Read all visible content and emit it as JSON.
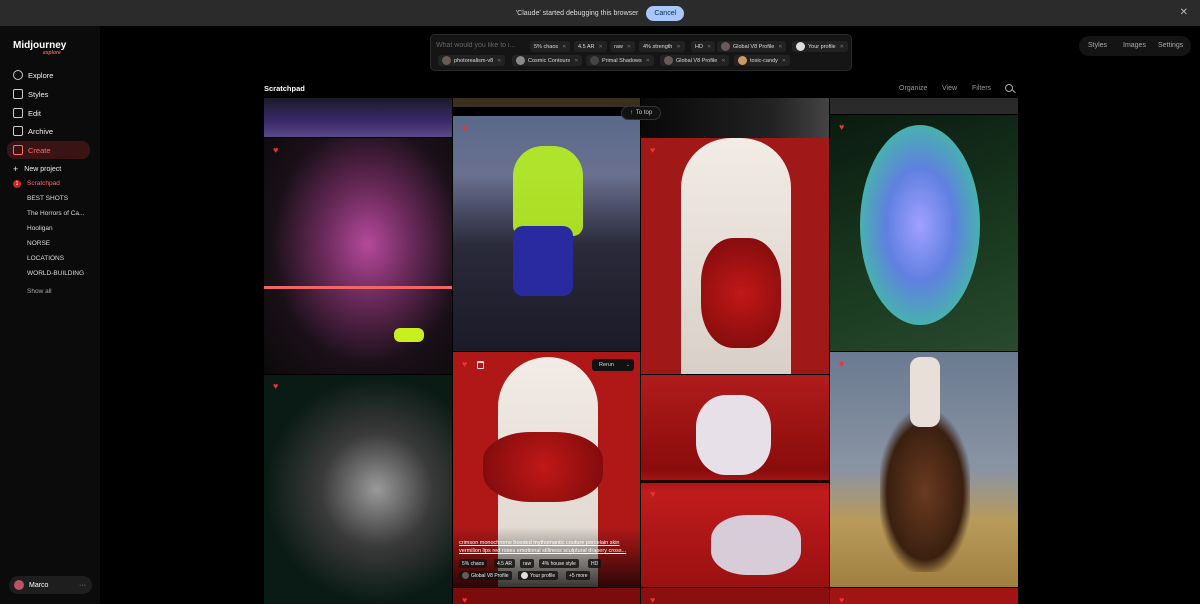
{
  "banner": {
    "message": "'Claude' started debugging this browser",
    "cancel_label": "Cancel",
    "close_icon": "close-icon"
  },
  "brand": {
    "name": "Midjourney",
    "tag": "explore"
  },
  "sidebar": {
    "items": [
      {
        "label": "Explore",
        "icon": "compass-icon"
      },
      {
        "label": "Styles",
        "icon": "styles-icon"
      },
      {
        "label": "Edit",
        "icon": "edit-icon"
      },
      {
        "label": "Archive",
        "icon": "archive-icon"
      },
      {
        "label": "Create",
        "icon": "create-icon"
      }
    ],
    "new_project": "New project",
    "projects": [
      "Scratchpad",
      "BEST SHOTS",
      "The Horrors of Ca...",
      "Hooligan",
      "NORSE",
      "LOCATIONS",
      "WORLD-BUILDING"
    ],
    "active_badge": "1",
    "show_all": "Show all"
  },
  "user": {
    "name": "Marco",
    "menu": "···"
  },
  "prompt": {
    "placeholder": "What would you like to i...",
    "chips_row1": [
      "5% chaos",
      "4.5 AR",
      "raw",
      "4% strength",
      "HD",
      "Global V8 Profile",
      "Your profile"
    ],
    "chips_row2": [
      "photorealism-v8",
      "Cosmic Contours",
      "Primal Shadows",
      "Global V8 Profile",
      "toxic-candy"
    ]
  },
  "topnav": {
    "styles": "Styles",
    "images": "Images",
    "settings": "Settings"
  },
  "subheader": {
    "title": "Scratchpad",
    "organize": "Organize",
    "view": "View",
    "filters": "Filters"
  },
  "grid": {
    "to_top": "To top",
    "rerun": "Rerun"
  },
  "hover_card": {
    "prompt_line1": "crimson monochrome hooded mythomantic couture porcelain skin",
    "prompt_line2": "vermilion lips red roses emotional stillness sculptural drapery cross...",
    "chips": [
      "5% chaos",
      "4.5 AR",
      "raw",
      "4% house style",
      "HD"
    ],
    "profiles": [
      "Global V8 Profile",
      "Your profile",
      "+5 more"
    ]
  },
  "colors": {
    "accent": "#e23d3d",
    "cancel_bg": "#a8c7fa"
  }
}
